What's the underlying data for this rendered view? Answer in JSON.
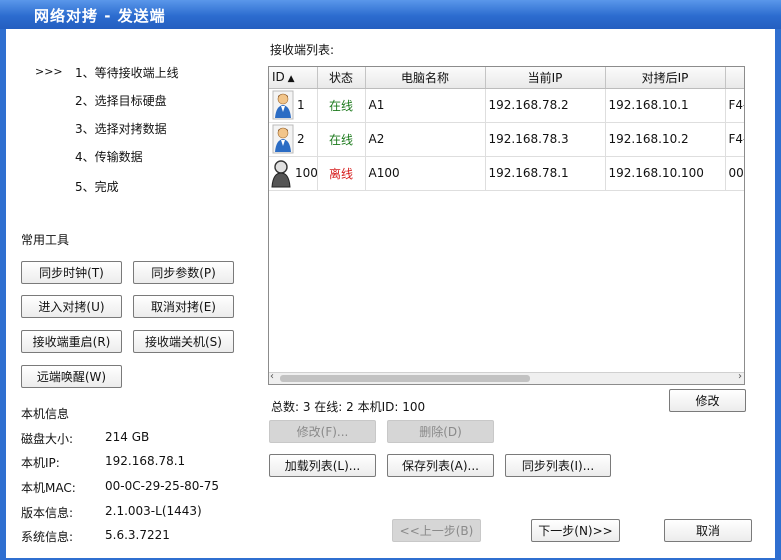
{
  "window": {
    "title": "网络对拷 - 发送端"
  },
  "steps": {
    "current_marker": ">>>",
    "items": [
      "1、等待接收端上线",
      "2、选择目标硬盘",
      "3、选择对拷数据",
      "4、传输数据",
      "5、完成"
    ]
  },
  "tools": {
    "title": "常用工具",
    "sync_clock": "同步时钟(T)",
    "sync_params": "同步参数(P)",
    "enter_copy": "进入对拷(U)",
    "cancel_copy": "取消对拷(E)",
    "restart_receiver": "接收端重启(R)",
    "shutdown_receiver": "接收端关机(S)",
    "remote_wake": "远端唤醒(W)"
  },
  "info": {
    "title": "本机信息",
    "rows": [
      {
        "label": "磁盘大小:",
        "value": "214 GB"
      },
      {
        "label": "本机IP:",
        "value": "192.168.78.1"
      },
      {
        "label": "本机MAC:",
        "value": "00-0C-29-25-80-75"
      },
      {
        "label": "版本信息:",
        "value": "2.1.003-L(1443)"
      },
      {
        "label": "系统信息:",
        "value": "5.6.3.7221"
      }
    ]
  },
  "receivers": {
    "title": "接收端列表:",
    "columns": [
      "ID",
      "状态",
      "电脑名称",
      "当前IP",
      "对拷后IP",
      ""
    ],
    "rows": [
      {
        "id": "1",
        "status": "在线",
        "online": true,
        "name": "A1",
        "current_ip": "192.168.78.2",
        "after_ip": "192.168.10.1",
        "mac": "F4-"
      },
      {
        "id": "2",
        "status": "在线",
        "online": true,
        "name": "A2",
        "current_ip": "192.168.78.3",
        "after_ip": "192.168.10.2",
        "mac": "F4-"
      },
      {
        "id": "100",
        "status": "离线",
        "online": false,
        "name": "A100",
        "current_ip": "192.168.78.1",
        "after_ip": "192.168.10.100",
        "mac": "00-"
      }
    ],
    "summary": "总数: 3 在线: 2 本机ID: 100"
  },
  "actions": {
    "modify": "修改",
    "modify_f": "修改(F)...",
    "delete": "删除(D)",
    "load_list": "加载列表(L)...",
    "save_list": "保存列表(A)...",
    "sync_list": "同步列表(I)...",
    "prev": "<<上一步(B)",
    "next": "下一步(N)>>",
    "cancel": "取消"
  },
  "colors": {
    "title_bar": "#2c6ccf",
    "online": "#1d7a1d",
    "offline": "#d61c1c"
  }
}
